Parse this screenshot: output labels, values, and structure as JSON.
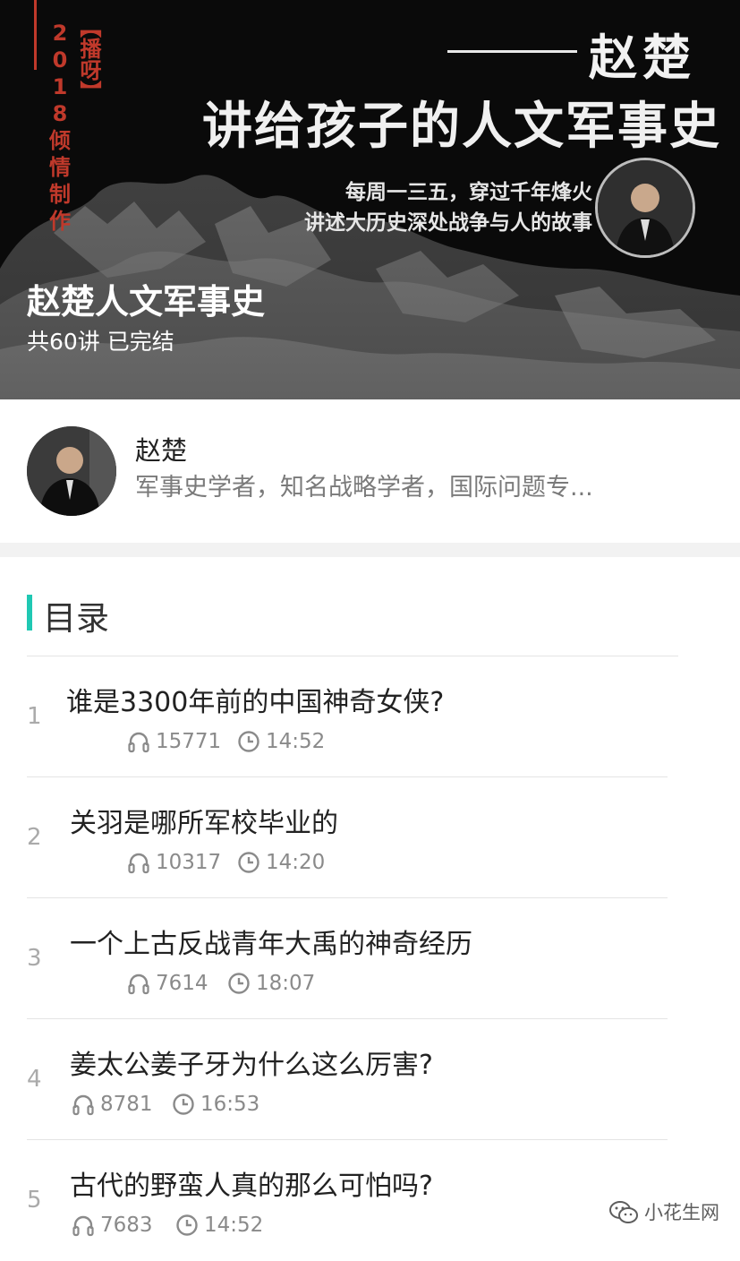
{
  "banner": {
    "tag": "【播呀】",
    "tag_chars": [
      "2",
      "0",
      "1",
      "8",
      "倾",
      "情",
      "制",
      "作"
    ],
    "author_sign": "赵楚",
    "headline": "讲给孩子的人文军事史",
    "slogan_line1": "每周一三五，穿过千年烽火",
    "slogan_line2": "讲述大历史深处战争与人的故事",
    "course_title": "赵楚人文军事史",
    "course_meta": "共60讲 已完结"
  },
  "author": {
    "name": "赵楚",
    "description": "军事史学者，知名战略学者，国际问题专..."
  },
  "catalog": {
    "title": "目录",
    "accent_color": "#1fc8b3",
    "items": [
      {
        "num": "1",
        "title": "谁是3300年前的中国神奇女侠?",
        "plays": "15771",
        "duration": "14:52"
      },
      {
        "num": "2",
        "title": "关羽是哪所军校毕业的",
        "plays": "10317",
        "duration": "14:20"
      },
      {
        "num": "3",
        "title": "一个上古反战青年大禹的神奇经历",
        "plays": "7614",
        "duration": "18:07"
      },
      {
        "num": "4",
        "title": "姜太公姜子牙为什么这么厉害?",
        "plays": "8781",
        "duration": "16:53"
      },
      {
        "num": "5",
        "title": "古代的野蛮人真的那么可怕吗?",
        "plays": "7683",
        "duration": "14:52"
      }
    ]
  },
  "watermark": {
    "text": "小花生网",
    "icon": "wechat-icon"
  }
}
